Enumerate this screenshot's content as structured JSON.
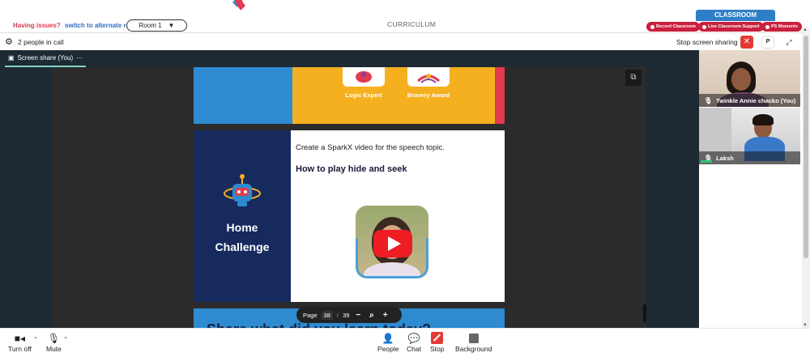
{
  "topbar": {
    "issues_question": "Having issues?",
    "issues_action": "switch to alternate room",
    "room_select_value": "Room 1",
    "curriculum_label": "CURRICULUM",
    "classroom_badge": "CLASSROOM",
    "pills": [
      "Record Classroom",
      "Live Classroom Support",
      "PS Moments"
    ],
    "colors": {
      "accent_red": "#c8203e",
      "accent_blue": "#2f7fc8"
    }
  },
  "callbar": {
    "people_count": "2 people in call",
    "stop_sharing_label": "Stop screen sharing",
    "p_button": "P"
  },
  "stage": {
    "tab_label": "Screen share (You)",
    "tab_more": "···",
    "slide1": {
      "awards": [
        "Logic Expert",
        "Bravery Award"
      ]
    },
    "slide2": {
      "title": [
        "Home",
        "Challenge"
      ],
      "line1": "Create a SparkX video for the speech topic.",
      "line2": "How to play hide and seek"
    },
    "slide3": {
      "text": "Share what did you learn today?"
    },
    "page_control": {
      "label": "Page",
      "current": "38",
      "sep": "/",
      "total": "39"
    }
  },
  "participants": [
    {
      "name": "Twinkle Annie chacko (You)"
    },
    {
      "name": "Laksh"
    }
  ],
  "bottombar": {
    "turn_off": "Turn off",
    "mute": "Mute",
    "people": "People",
    "chat": "Chat",
    "stop": "Stop",
    "background": "Background"
  }
}
